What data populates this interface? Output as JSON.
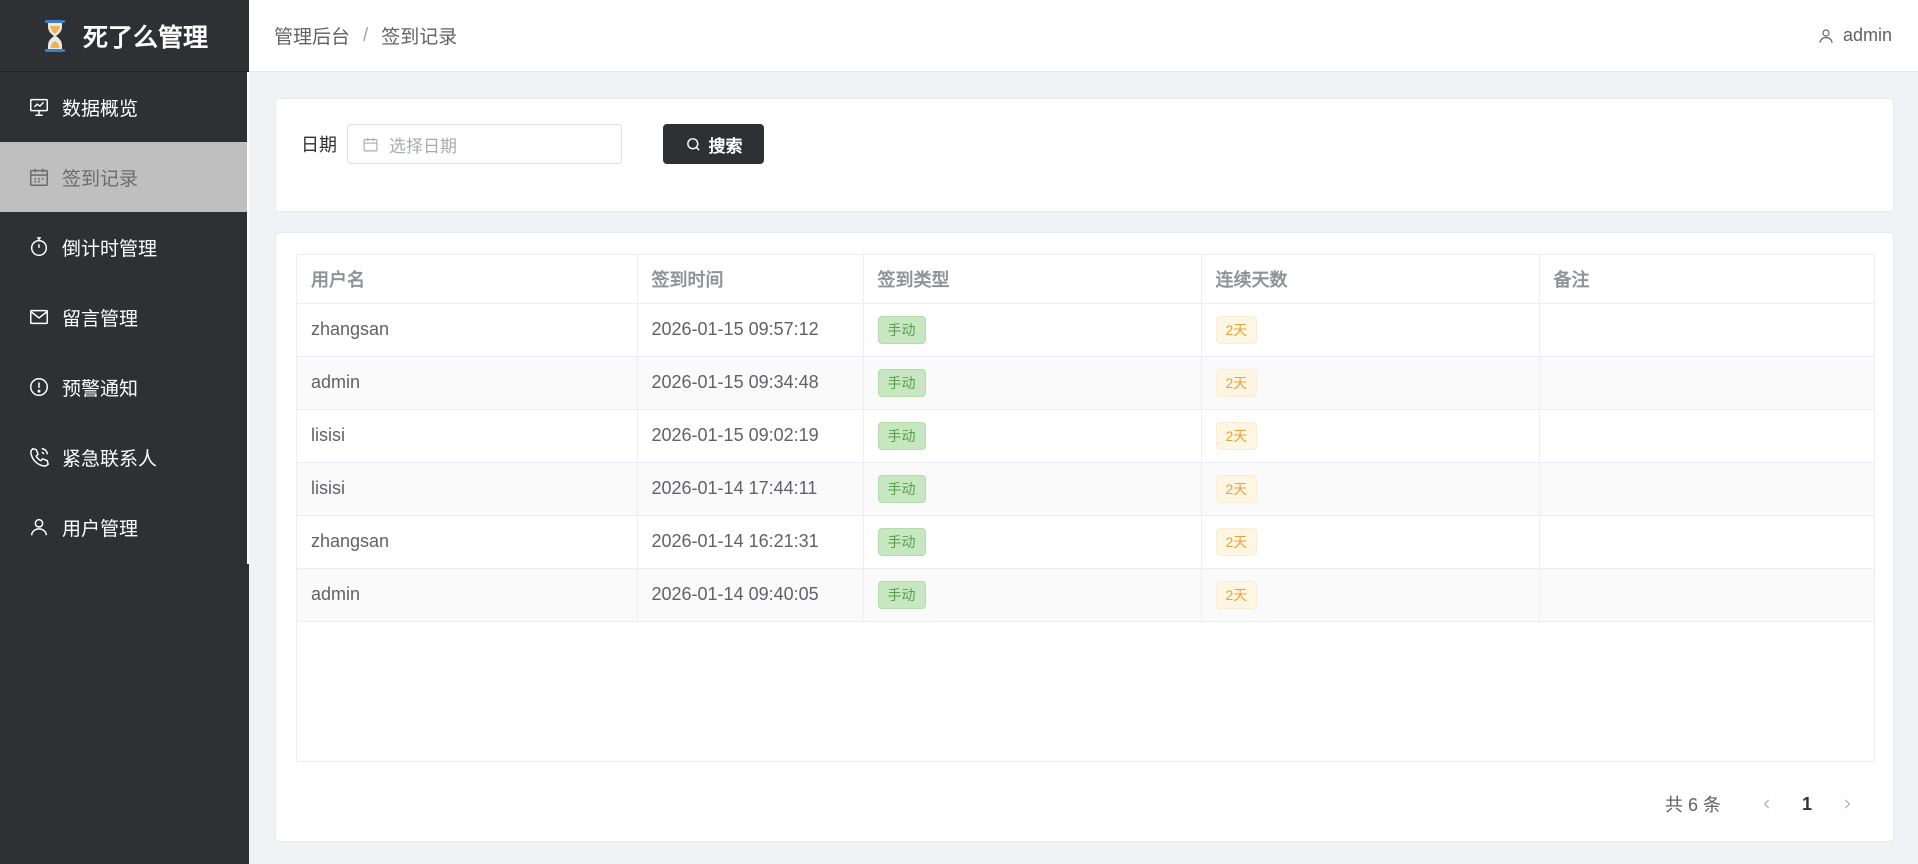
{
  "app": {
    "title": "死了么管理"
  },
  "sidebar": {
    "items": [
      {
        "label": "数据概览",
        "icon": "presentation-icon",
        "active": false
      },
      {
        "label": "签到记录",
        "icon": "calendar-icon",
        "active": true
      },
      {
        "label": "倒计时管理",
        "icon": "stopwatch-icon",
        "active": false
      },
      {
        "label": "留言管理",
        "icon": "mail-icon",
        "active": false
      },
      {
        "label": "预警通知",
        "icon": "warning-icon",
        "active": false
      },
      {
        "label": "紧急联系人",
        "icon": "phone-icon",
        "active": false
      },
      {
        "label": "用户管理",
        "icon": "user-icon",
        "active": false
      }
    ]
  },
  "header": {
    "breadcrumb": [
      "管理后台",
      "签到记录"
    ],
    "separator": "/",
    "username": "admin"
  },
  "search": {
    "date_label": "日期",
    "date_placeholder": "选择日期",
    "search_label": "搜索"
  },
  "table": {
    "columns": [
      "用户名",
      "签到时间",
      "签到类型",
      "连续天数",
      "备注"
    ],
    "rows": [
      {
        "username": "zhangsan",
        "time": "2026-01-15 09:57:12",
        "type": "手动",
        "days": "2天",
        "note": ""
      },
      {
        "username": "admin",
        "time": "2026-01-15 09:34:48",
        "type": "手动",
        "days": "2天",
        "note": ""
      },
      {
        "username": "lisisi",
        "time": "2026-01-15 09:02:19",
        "type": "手动",
        "days": "2天",
        "note": ""
      },
      {
        "username": "lisisi",
        "time": "2026-01-14 17:44:11",
        "type": "手动",
        "days": "2天",
        "note": ""
      },
      {
        "username": "zhangsan",
        "time": "2026-01-14 16:21:31",
        "type": "手动",
        "days": "2天",
        "note": ""
      },
      {
        "username": "admin",
        "time": "2026-01-14 09:40:05",
        "type": "手动",
        "days": "2天",
        "note": ""
      }
    ]
  },
  "pagination": {
    "total_text": "共 6 条",
    "current_page": "1"
  },
  "colors": {
    "sidebar_bg": "#2f3033",
    "active_item_bg": "#bfbfbf",
    "tag_type_bg": "#c6e7c0",
    "tag_days_bg": "#fdf6e3",
    "button_bg": "#2f3033"
  }
}
